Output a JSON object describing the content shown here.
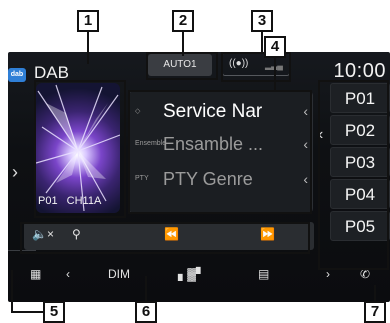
{
  "source": "DAB",
  "clock": "10:00",
  "top": {
    "auto_button": "AUTO1"
  },
  "art": {
    "preset": "P01",
    "channel": "CH11A"
  },
  "info": {
    "service": {
      "tag": "◇",
      "text": "Service Nar"
    },
    "ensemble": {
      "tag": "Ensemble",
      "text": "Ensamble ..."
    },
    "pty": {
      "tag": "PTY",
      "text": "PTY Genre"
    }
  },
  "presets": [
    "P01",
    "P02",
    "P03",
    "P04",
    "P05"
  ],
  "callouts": [
    "1",
    "2",
    "3",
    "4",
    "5",
    "6",
    "7"
  ],
  "bottom": {
    "dim": "DIM"
  }
}
